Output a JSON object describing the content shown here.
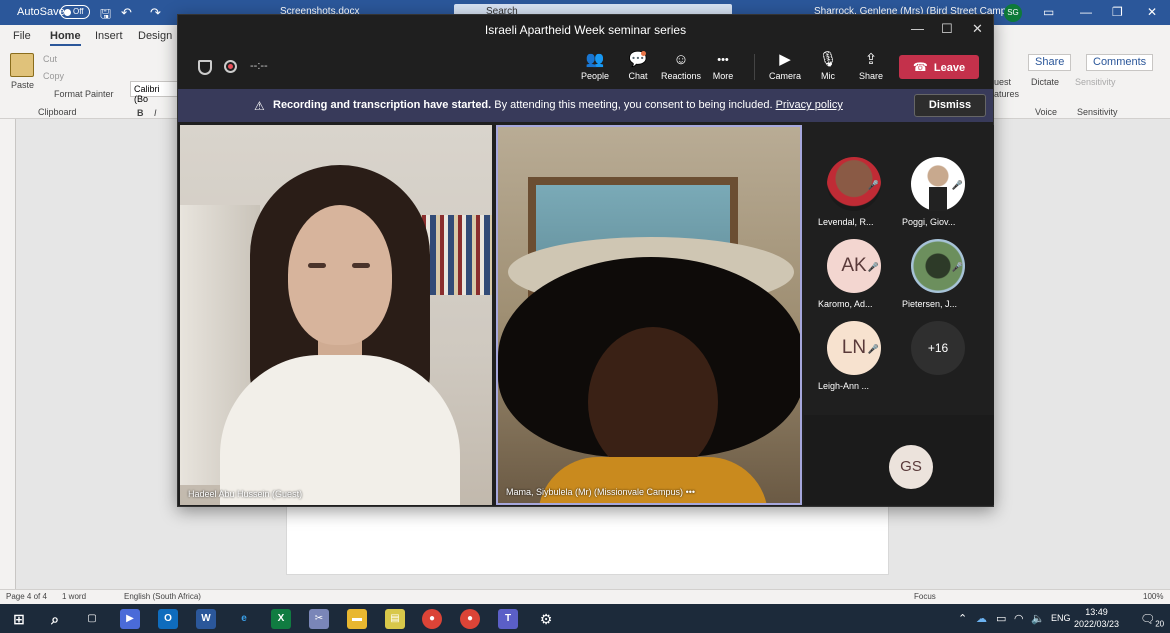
{
  "word": {
    "autosave_label": "AutoSave",
    "autosave_state": "Off",
    "document_name": "Screenshots.docx",
    "search_placeholder": "Search",
    "account_name": "Sharrock, Genlene (Mrs) (Bird Street Campus)",
    "account_initials": "SG",
    "tabs": [
      "File",
      "Home",
      "Insert",
      "Design"
    ],
    "active_tab": "Home",
    "clipboard": {
      "paste": "Paste",
      "cut": "Cut",
      "copy": "Copy",
      "format_painter": "Format Painter",
      "group_label": "Clipboard"
    },
    "font_name": "Calibri (Bo",
    "share_label": "Share",
    "comments_label": "Comments",
    "voice_group": {
      "dictate": "Dictate",
      "label": "Voice"
    },
    "sensitivity_group": {
      "button": "Sensitivity",
      "label": "Sensitivity"
    },
    "guest_features": [
      "uest",
      "atures"
    ],
    "status": {
      "page": "Page 4 of 4",
      "words": "1 word",
      "language": "English (South Africa)",
      "focus": "Focus",
      "zoom": "100%"
    }
  },
  "teams": {
    "meeting_title": "Israeli Apartheid Week seminar series",
    "timer": "--:--",
    "toolbar": [
      {
        "label": "People",
        "icon": "people-icon",
        "glyph": "👥"
      },
      {
        "label": "Chat",
        "icon": "chat-icon",
        "glyph": "💬"
      },
      {
        "label": "Reactions",
        "icon": "reactions-icon",
        "glyph": "☺"
      },
      {
        "label": "More",
        "icon": "more-icon",
        "glyph": "•••"
      },
      {
        "label": "Camera",
        "icon": "camera-off-icon",
        "glyph": "▶"
      },
      {
        "label": "Mic",
        "icon": "mic-off-icon",
        "glyph": "🎙"
      },
      {
        "label": "Share",
        "icon": "share-icon",
        "glyph": "⇪"
      }
    ],
    "leave_label": "Leave",
    "banner": {
      "bold_text": "Recording and transcription have started.",
      "text": "By attending this meeting, you consent to being included.",
      "link": "Privacy policy",
      "dismiss": "Dismiss"
    },
    "videos": [
      {
        "name": "Hadeel Abu Hussein (Guest)"
      },
      {
        "name": "Mama, Siybulela (Mr) (Missionvale Campus)",
        "more": "•••"
      }
    ],
    "participants": [
      {
        "name": "Levendal, R...",
        "initials": "",
        "style": "photo1",
        "muted": true
      },
      {
        "name": "Poggi, Giov...",
        "initials": "",
        "style": "photo2",
        "muted": true
      },
      {
        "name": "Karomo, Ad...",
        "initials": "AK",
        "style": "initials",
        "muted": true
      },
      {
        "name": "Pietersen, J...",
        "initials": "",
        "style": "photo3",
        "muted": true
      },
      {
        "name": "Leigh-Ann ...",
        "initials": "LN",
        "style": "initials",
        "muted": true
      },
      {
        "name": "",
        "initials": "+16",
        "style": "more",
        "muted": false
      }
    ],
    "self_initials": "GS"
  },
  "taskbar": {
    "language": "ENG",
    "time": "13:49",
    "date": "2022/03/23",
    "notifications": "20"
  }
}
